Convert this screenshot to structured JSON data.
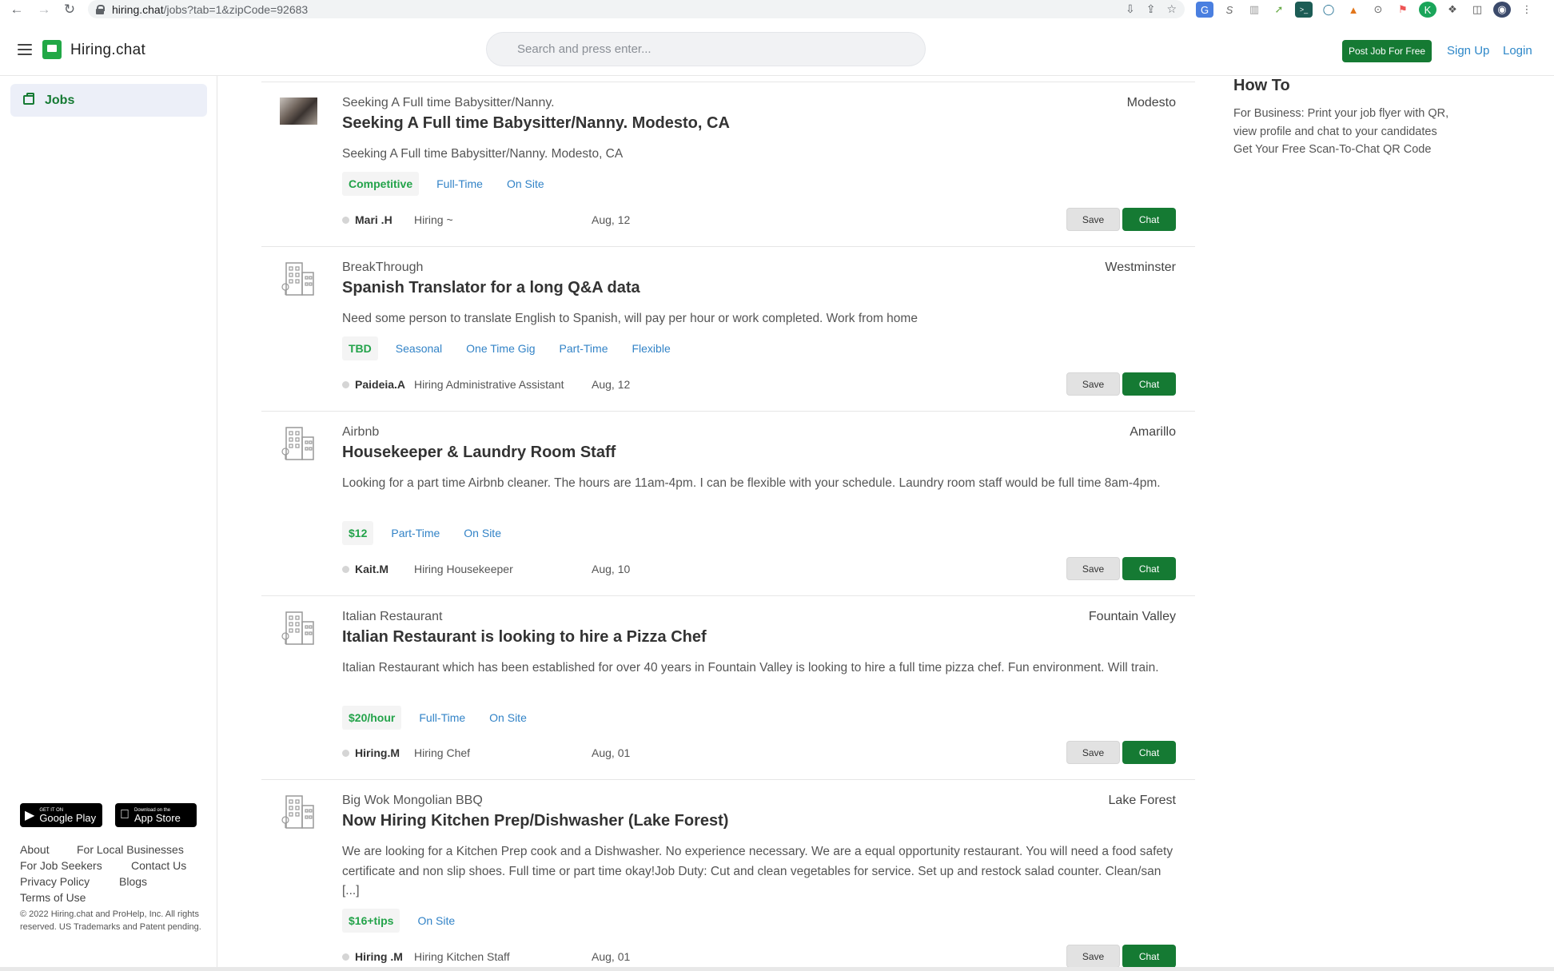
{
  "browser": {
    "url_host": "hiring.chat",
    "url_path": "/jobs?tab=1&zipCode=92683"
  },
  "header": {
    "logo": "Hiring.chat",
    "search_placeholder": "Search and press enter...",
    "post_job": "Post Job For Free",
    "sign_up": "Sign Up",
    "login": "Login"
  },
  "sidebar": {
    "jobs_label": "Jobs",
    "google_play": {
      "small": "GET IT ON",
      "large": "Google Play"
    },
    "app_store": {
      "small": "Download on the",
      "large": "App Store"
    },
    "links": {
      "about": "About",
      "local_businesses": "For Local Businesses",
      "job_seekers": "For Job Seekers",
      "contact": "Contact Us",
      "privacy": "Privacy Policy",
      "blogs": "Blogs",
      "terms": "Terms of Use"
    },
    "copyright": "© 2022 Hiring.chat and ProHelp, Inc. All rights reserved. US Trademarks and Patent pending."
  },
  "jobs": [
    {
      "company": "Seeking A Full time Babysitter/Nanny.",
      "location": "Modesto",
      "title": "Seeking A Full time Babysitter/Nanny. Modesto, CA",
      "description": "Seeking A Full time Babysitter/Nanny. Modesto, CA",
      "pay": "Competitive",
      "tags": [
        "Full-Time",
        "On Site"
      ],
      "poster": "Mari .H",
      "role": "Hiring ~",
      "date": "Aug, 12",
      "save": "Save",
      "chat": "Chat"
    },
    {
      "company": "BreakThrough",
      "location": "Westminster",
      "title": "Spanish Translator for a long Q&A data",
      "description": "Need some person to translate English to Spanish, will pay per hour or work completed. Work from home",
      "pay": "TBD",
      "tags": [
        "Seasonal",
        "One Time Gig",
        "Part-Time",
        "Flexible"
      ],
      "poster": "Paideia.A",
      "role": "Hiring Administrative Assistant",
      "date": "Aug, 12",
      "save": "Save",
      "chat": "Chat"
    },
    {
      "company": "Airbnb",
      "location": "Amarillo",
      "title": "Housekeeper & Laundry Room Staff",
      "description": "Looking for a part time Airbnb cleaner. The hours are 11am-4pm. I can be flexible with your schedule. Laundry room staff would be full time 8am-4pm.",
      "pay": "$12",
      "tags": [
        "Part-Time",
        "On Site"
      ],
      "poster": "Kait.M",
      "role": "Hiring Housekeeper",
      "date": "Aug, 10",
      "save": "Save",
      "chat": "Chat"
    },
    {
      "company": "Italian Restaurant",
      "location": "Fountain Valley",
      "title": "Italian Restaurant is looking to hire a Pizza Chef",
      "description": "Italian Restaurant which has been established for over 40 years in Fountain Valley is looking to hire a full time pizza chef. Fun environment. Will train.",
      "pay": "$20/hour",
      "tags": [
        "Full-Time",
        "On Site"
      ],
      "poster": "Hiring.M",
      "role": "Hiring Chef",
      "date": "Aug, 01",
      "save": "Save",
      "chat": "Chat"
    },
    {
      "company": "Big Wok Mongolian BBQ",
      "location": "Lake Forest",
      "title": "Now Hiring Kitchen Prep/Dishwasher (Lake Forest)",
      "description": "We are looking for a Kitchen Prep cook and a Dishwasher. No experience necessary. We are a equal opportunity restaurant. You will need a food safety certificate and non slip shoes. Full time or part time okay!Job Duty: Cut and clean vegetables for service. Set up and restock salad counter. Clean/san [...]",
      "pay": "$16+tips",
      "tags": [
        "On Site"
      ],
      "poster": "Hiring .M",
      "role": "Hiring Kitchen Staff",
      "date": "Aug, 01",
      "save": "Save",
      "chat": "Chat"
    }
  ],
  "howto": {
    "heading": "How To",
    "business_text": "For Business: Print your job flyer with QR, view profile and chat to your candidates",
    "qr_text": "Get Your Free Scan-To-Chat QR Code"
  },
  "icons": {
    "back": "back-arrow-icon",
    "forward": "forward-arrow-icon",
    "reload": "reload-icon",
    "menu": "hamburger-icon",
    "jobs": "briefcase-icon",
    "company_placeholder": "building-icon"
  },
  "colors": {
    "brand_green": "#157a33",
    "pay_green": "#23a34a",
    "tag_blue": "#3283c7",
    "link_blue": "#2d87c8"
  }
}
